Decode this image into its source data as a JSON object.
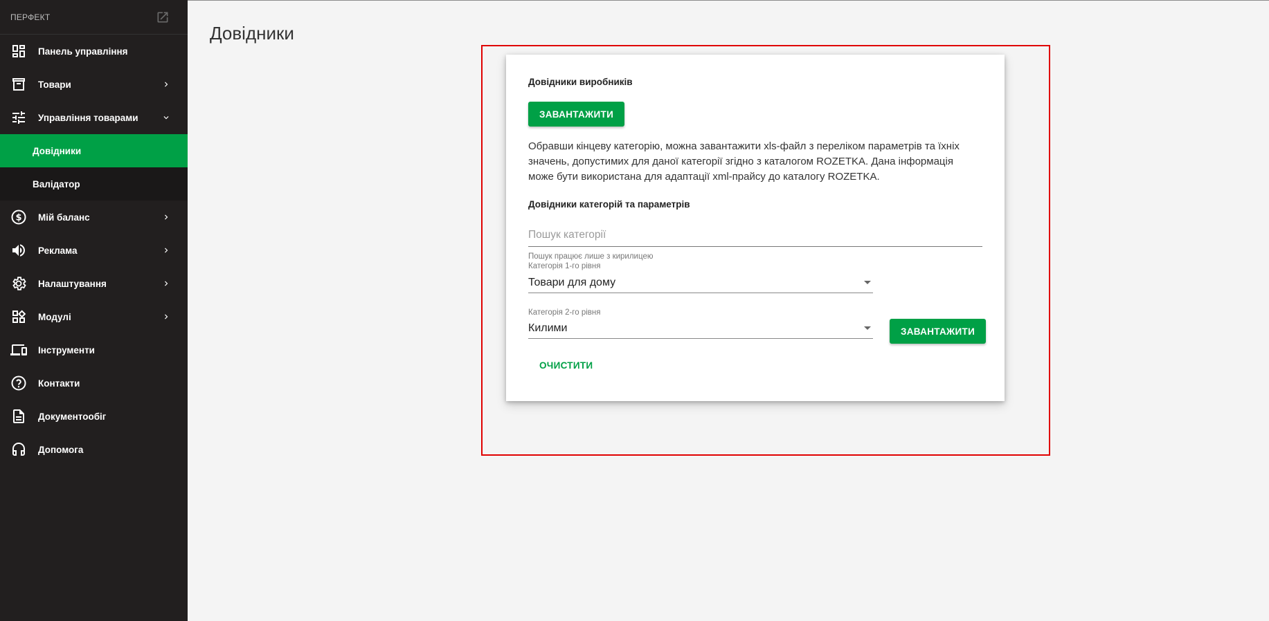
{
  "sidebar": {
    "brand": "ПЕРФЕКТ",
    "items": [
      {
        "label": "Панель управління",
        "icon": "dashboard-icon"
      },
      {
        "label": "Товари",
        "icon": "archive-icon"
      },
      {
        "label": "Управління товарами",
        "icon": "tune-icon"
      },
      {
        "label": "Мій баланс",
        "icon": "dollar-icon"
      },
      {
        "label": "Реклама",
        "icon": "speaker-icon"
      },
      {
        "label": "Налаштування",
        "icon": "gear-icon"
      },
      {
        "label": "Модулі",
        "icon": "widgets-icon"
      },
      {
        "label": "Інструменти",
        "icon": "devices-icon"
      },
      {
        "label": "Контакти",
        "icon": "help-icon"
      },
      {
        "label": "Документообіг",
        "icon": "document-icon"
      },
      {
        "label": "Допомога",
        "icon": "headset-icon"
      }
    ],
    "subitems": [
      {
        "label": "Довідники",
        "active": true
      },
      {
        "label": "Валідатор",
        "active": false
      }
    ]
  },
  "page": {
    "title": "Довідники"
  },
  "card": {
    "manufacturers_title": "Довідники виробників",
    "download_label": "ЗАВАНТАЖИТИ",
    "description": "Обравши кінцеву категорію, можна завантажити xls-файл з переліком параметрів та їхніх значень, допустимих для даної категорії згідно з каталогом ROZETKA. Дана інформація може бути використана для адаптації xml-прайсу до каталогу ROZETKA.",
    "categories_title": "Довідники категорій та параметрів",
    "search_placeholder": "Пошук категорії",
    "search_hint": "Пошук працює лише з кирилицею",
    "level1_label": "Категорія 1-го рівня",
    "level1_value": "Товари для дому",
    "level2_label": "Категорія 2-го рівня",
    "level2_value": "Килими",
    "download2_label": "ЗАВАНТАЖИТИ",
    "clear_label": "ОЧИСТИТИ"
  },
  "colors": {
    "accent": "#00a046",
    "sidebar_bg": "#221f1f",
    "highlight": "#e00000"
  }
}
